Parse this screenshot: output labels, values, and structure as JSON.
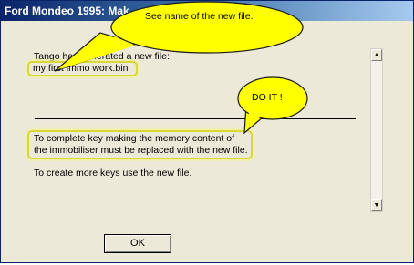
{
  "window": {
    "title": "Ford Mondeo 1995: Mak"
  },
  "dialog": {
    "line1": "Tango has generated a new file:",
    "filename": "my first immo work.bin",
    "instruction_line1": "To complete key making the memory content of",
    "instruction_line2": "the immobiliser must be replaced with the new file.",
    "more_keys": "To create more keys use the new file.",
    "ok_label": "OK"
  },
  "callouts": {
    "name_note": "See name of the new file.",
    "do_it_note": "DO IT !"
  },
  "colors": {
    "callout_fill": "#ffff00",
    "highlight_border": "#d8d83a",
    "titlebar": "#0a246a"
  },
  "icons": [
    "scroll-up-arrow-icon",
    "scroll-down-arrow-icon"
  ]
}
